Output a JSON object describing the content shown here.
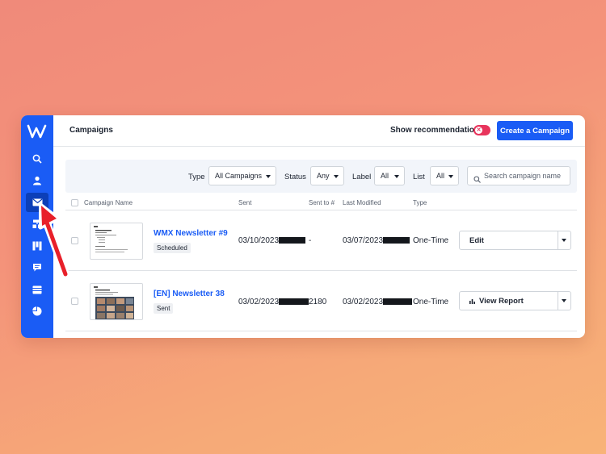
{
  "sidebar": {
    "logo": "W",
    "items": [
      {
        "icon": "search-icon",
        "active": false
      },
      {
        "icon": "contacts-icon",
        "active": false
      },
      {
        "icon": "envelope-icon",
        "active": true
      },
      {
        "icon": "automations-icon",
        "active": false
      },
      {
        "icon": "pipelines-icon",
        "active": false
      },
      {
        "icon": "conversations-icon",
        "active": false
      },
      {
        "icon": "website-icon",
        "active": false
      },
      {
        "icon": "reports-icon",
        "active": false
      }
    ]
  },
  "header": {
    "title": "Campaigns",
    "show_recommendations_label": "Show recommendations",
    "create_button_label": "Create a Campaign"
  },
  "filters": {
    "type_label": "Type",
    "type_value": "All Campaigns",
    "status_label": "Status",
    "status_value": "Any",
    "label_label": "Label",
    "label_value": "All",
    "list_label": "List",
    "list_value": "All",
    "search_placeholder": "Search campaign name"
  },
  "table": {
    "columns": [
      "Campaign Name",
      "Sent",
      "Sent to #",
      "Last Modified",
      "Type"
    ],
    "rows": [
      {
        "name": "WMX Newsletter #9",
        "status": "Scheduled",
        "sent": "03/10/2023",
        "sent_to": "-",
        "last_modified": "03/07/2023",
        "type": "One-Time",
        "action": "Edit"
      },
      {
        "name": "[EN] Newsletter 38",
        "status": "Sent",
        "sent": "03/02/2023",
        "sent_to": "2180",
        "last_modified": "03/02/2023",
        "type": "One-Time",
        "action": "View Report"
      }
    ]
  },
  "colors": {
    "accent": "#1a5cf5",
    "toggle_off": "#e8345c",
    "annotation_arrow": "#e8202a"
  }
}
